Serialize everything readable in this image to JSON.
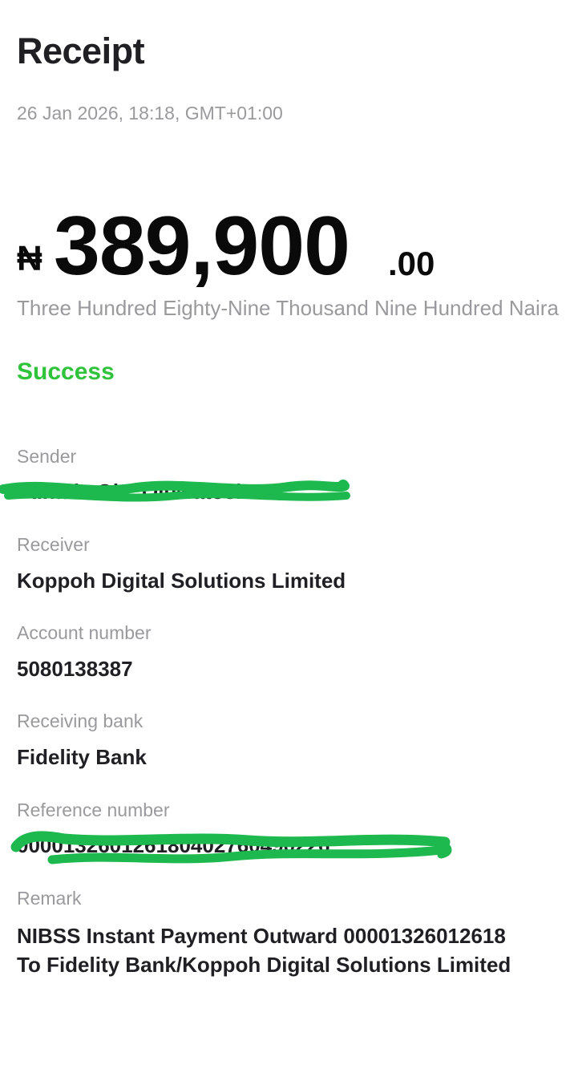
{
  "header": {
    "title": "Receipt",
    "datetime": "26 Jan 2026, 18:18, GMT+01:00"
  },
  "amount": {
    "currency_symbol": "₦",
    "whole": "389,900",
    "decimal": ".00",
    "in_words": "Three Hundred Eighty-Nine Thousand Nine Hundred Naira"
  },
  "status": {
    "text": "Success",
    "color": "#2fc23b"
  },
  "details": {
    "sender": {
      "label": "Sender",
      "value": "Funade Ol... Oluwatosin"
    },
    "receiver": {
      "label": "Receiver",
      "value": "Koppoh Digital Solutions Limited"
    },
    "account_number": {
      "label": "Account number",
      "value": "5080138387"
    },
    "receiving_bank": {
      "label": "Receiving bank",
      "value": "Fidelity Bank"
    },
    "reference_number": {
      "label": "Reference number",
      "value": "000013260126180402760490226"
    },
    "remark": {
      "label": "Remark",
      "line1": "NIBSS Instant Payment Outward 00001326012618",
      "line2": "To Fidelity Bank/Koppoh Digital Solutions Limited"
    }
  },
  "redaction": {
    "color": "#1db94e"
  }
}
